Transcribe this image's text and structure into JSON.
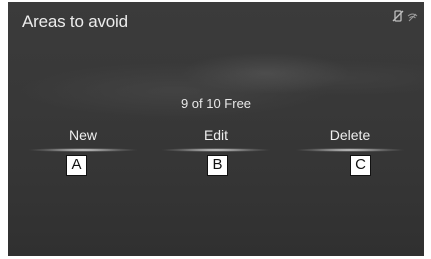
{
  "screen": {
    "title": "Areas to avoid",
    "status_icons": [
      "phone-off-icon",
      "signal-icon"
    ]
  },
  "main": {
    "free_count": "9 of 10 Free",
    "buttons": [
      {
        "label": "New"
      },
      {
        "label": "Edit"
      },
      {
        "label": "Delete"
      }
    ]
  },
  "callouts": [
    "A",
    "B",
    "C"
  ]
}
